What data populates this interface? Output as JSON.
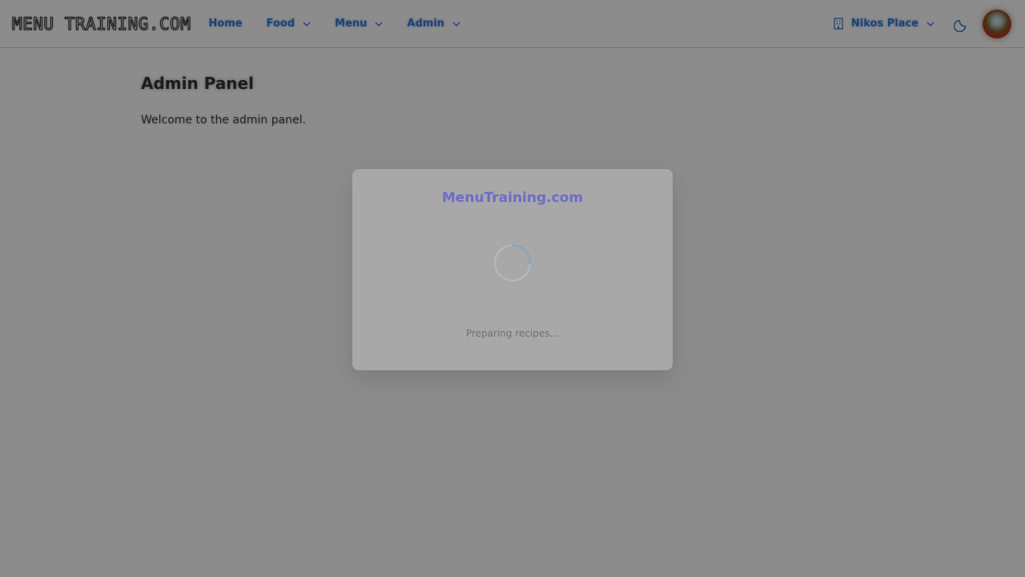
{
  "navbar": {
    "brand": "MENU TRAINING.COM",
    "items": [
      {
        "label": "Home",
        "has_dropdown": false
      },
      {
        "label": "Food",
        "has_dropdown": true
      },
      {
        "label": "Menu",
        "has_dropdown": true
      },
      {
        "label": "Admin",
        "has_dropdown": true
      }
    ],
    "restaurant": {
      "label": "Nikos Place",
      "icon": "building-icon"
    },
    "theme_toggle_icon": "moon-icon",
    "avatar_icon": "avatar"
  },
  "page": {
    "title": "Admin Panel",
    "text": "Welcome to the admin panel."
  },
  "loading_modal": {
    "title": "MenuTraining.com",
    "status": "Preparing recipes..."
  },
  "colors": {
    "accent": "#3a7bd5",
    "modal_title": "#6c6cc7",
    "overlay": "rgba(0,0,0,0.45)"
  }
}
